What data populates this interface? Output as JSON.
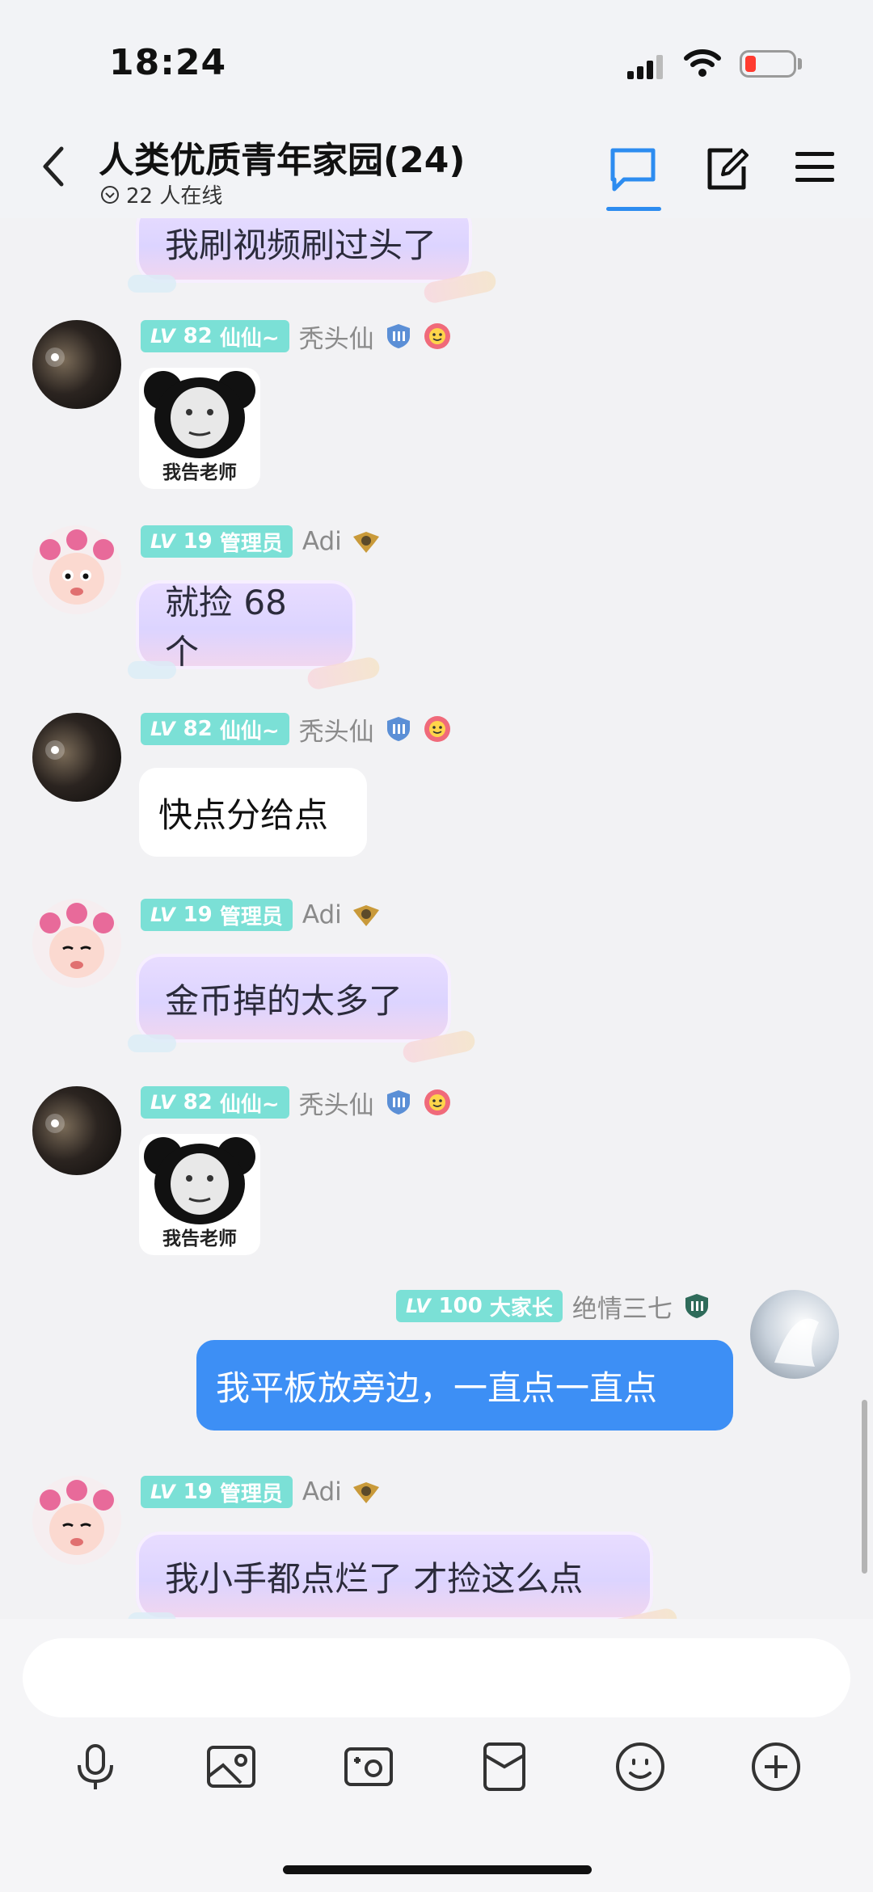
{
  "status": {
    "time": "18:24"
  },
  "header": {
    "title": "人类优质青年家园(24)",
    "online": "22 人在线"
  },
  "members": {
    "xian": {
      "level_tag": "LV",
      "level": "82",
      "title": "仙仙~",
      "name": "秃头仙"
    },
    "adi": {
      "level_tag": "LV",
      "level": "19",
      "title": "管理员",
      "name": "Adi"
    },
    "me": {
      "level_tag": "LV",
      "level": "100",
      "title": "大家长",
      "name": "绝情三七"
    }
  },
  "messages": {
    "m0": "我刷视频刷过头了",
    "m2": "就捡 68 个",
    "m3": "快点分给点",
    "m4": "金币掉的太多了",
    "m6": "我平板放旁边，一直点一直点",
    "m7": "我小手都点烂了 才捡这么点"
  },
  "sticker": {
    "caption": "我告老师"
  },
  "input": {
    "placeholder": ""
  },
  "colors": {
    "accent": "#2d8cf0",
    "my_bubble": "#3d8ff5",
    "level_badge": "#7be0d6"
  }
}
